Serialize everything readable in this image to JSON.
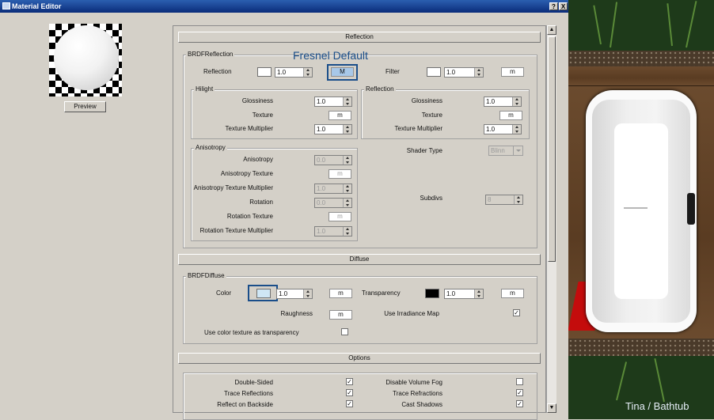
{
  "window": {
    "title": "Material Editor",
    "help_button": "?",
    "close_button": "X"
  },
  "preview": {
    "button_label": "Preview"
  },
  "annotation": {
    "fresnel_note": "Fresnel Default",
    "scene_caption": "Tina / Bathtub"
  },
  "reflection": {
    "section_header": "Reflection",
    "group_label": "BRDFReflection",
    "reflection_label": "Reflection",
    "reflection_value": "1.0",
    "reflection_texture": "M",
    "filter_label": "Filter",
    "filter_value": "1.0",
    "filter_texture": "m",
    "hilight": {
      "group_label": "Hilight",
      "glossiness_label": "Glossiness",
      "glossiness_value": "1.0",
      "texture_label": "Texture",
      "texture_button": "m",
      "texture_multiplier_label": "Texture Multiplier",
      "texture_multiplier_value": "1.0"
    },
    "reflection_sub": {
      "group_label": "Reflection",
      "glossiness_label": "Glossiness",
      "glossiness_value": "1.0",
      "texture_label": "Texture",
      "texture_button": "m",
      "texture_multiplier_label": "Texture Multiplier",
      "texture_multiplier_value": "1.0"
    },
    "anisotropy": {
      "group_label": "Anisotropy",
      "anisotropy_label": "Anisotropy",
      "anisotropy_value": "0.0",
      "anisotropy_texture_label": "Anisotropy Texture",
      "anisotropy_texture_button": "m",
      "anisotropy_texture_multiplier_label": "Anisotropy Texture Multiplier",
      "anisotropy_texture_multiplier_value": "1.0",
      "rotation_label": "Rotation",
      "rotation_value": "0.0",
      "rotation_texture_label": "Rotation Texture",
      "rotation_texture_button": "m",
      "rotation_texture_multiplier_label": "Rotation Texture Multiplier",
      "rotation_texture_multiplier_value": "1.0"
    },
    "shader_type_label": "Shader Type",
    "shader_type_value": "Blinn",
    "subdivs_label": "Subdivs",
    "subdivs_value": "8"
  },
  "diffuse": {
    "section_header": "Diffuse",
    "group_label": "BRDFDiffuse",
    "color_label": "Color",
    "color_value": "1.0",
    "color_texture": "m",
    "transparency_label": "Transparency",
    "transparency_value": "1.0",
    "transparency_texture": "m",
    "roughness_label": "Raughness",
    "roughness_texture": "m",
    "irradiance_label": "Use Irradiance Map",
    "irradiance_checked": true,
    "color_as_transparency_label": "Use color texture as transparency",
    "color_as_transparency_checked": false
  },
  "options": {
    "section_header": "Options",
    "double_sided_label": "Double-Sided",
    "double_sided_checked": true,
    "trace_reflections_label": "Trace Reflections",
    "trace_reflections_checked": true,
    "reflect_backside_label": "Reflect on Backside",
    "reflect_backside_checked": true,
    "disable_volume_fog_label": "Disable Volume Fog",
    "disable_volume_fog_checked": false,
    "trace_refractions_label": "Trace Refractions",
    "trace_refractions_checked": true,
    "cast_shadows_label": "Cast Shadows",
    "cast_shadows_checked": true
  },
  "colors": {
    "title_bar": "#0a2c7a",
    "highlight": "#1a4e8a",
    "transparency_swatch": "#000000",
    "color_swatch": "#cfe6f5",
    "reflection_button": "#a8c8e8"
  },
  "checkmark": "✓"
}
